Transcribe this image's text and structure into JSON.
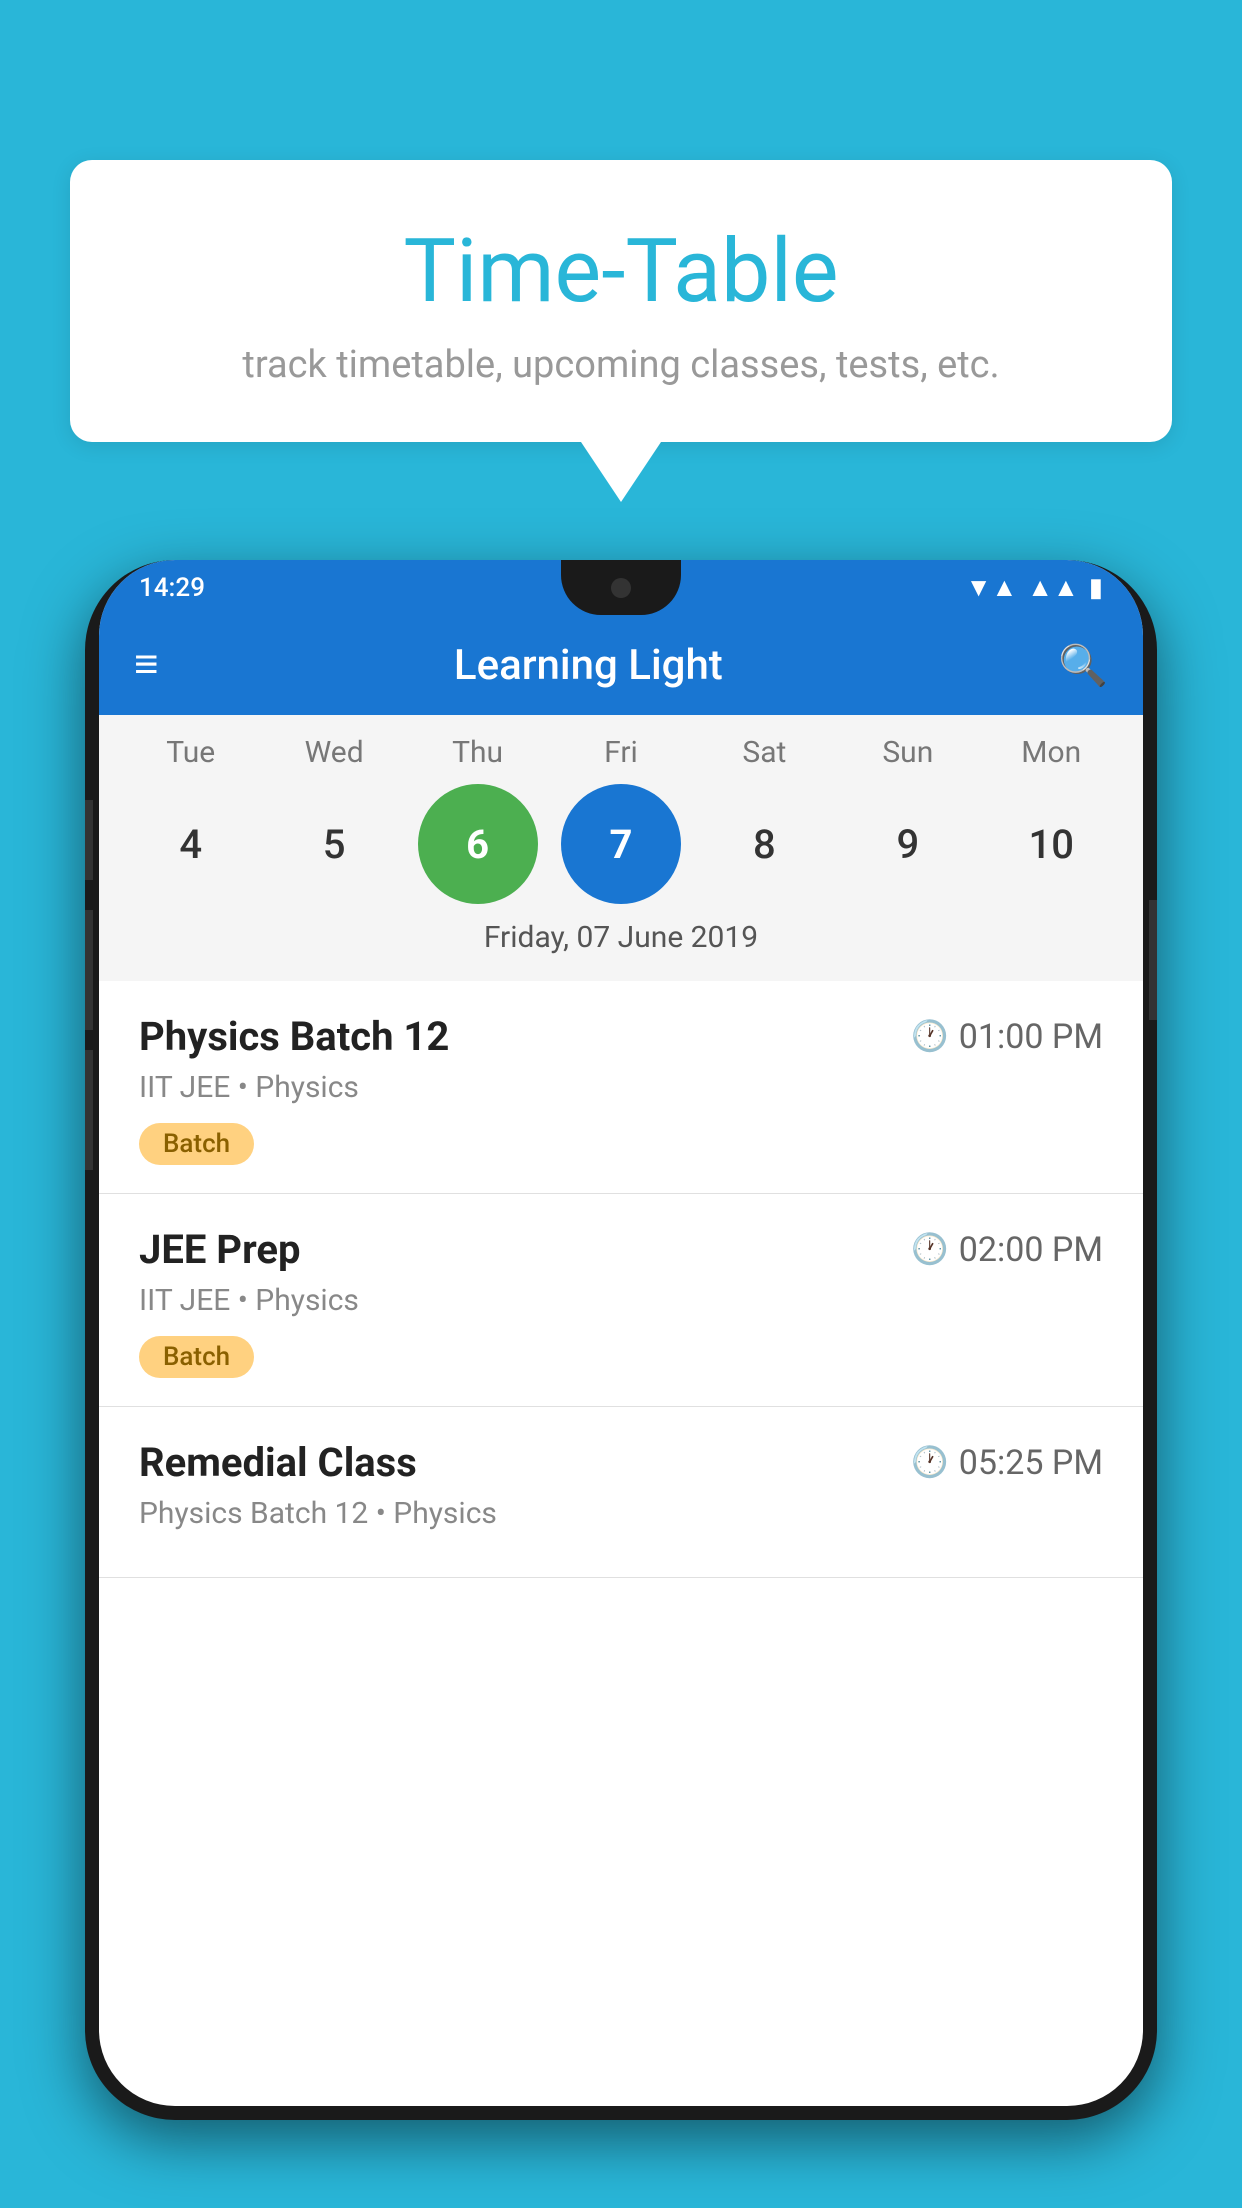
{
  "background": {
    "color": "#29b6d8"
  },
  "speech_bubble": {
    "title": "Time-Table",
    "subtitle": "track timetable, upcoming classes, tests, etc."
  },
  "phone": {
    "status_bar": {
      "time": "14:29"
    },
    "app_bar": {
      "title": "Learning Light"
    },
    "calendar": {
      "days": [
        {
          "label": "Tue",
          "number": "4",
          "state": "normal"
        },
        {
          "label": "Wed",
          "number": "5",
          "state": "normal"
        },
        {
          "label": "Thu",
          "number": "6",
          "state": "today"
        },
        {
          "label": "Fri",
          "number": "7",
          "state": "selected"
        },
        {
          "label": "Sat",
          "number": "8",
          "state": "normal"
        },
        {
          "label": "Sun",
          "number": "9",
          "state": "normal"
        },
        {
          "label": "Mon",
          "number": "10",
          "state": "normal"
        }
      ],
      "selected_date_label": "Friday, 07 June 2019"
    },
    "classes": [
      {
        "name": "Physics Batch 12",
        "time": "01:00 PM",
        "subtitle": "IIT JEE • Physics",
        "badge": "Batch"
      },
      {
        "name": "JEE Prep",
        "time": "02:00 PM",
        "subtitle": "IIT JEE • Physics",
        "badge": "Batch"
      },
      {
        "name": "Remedial Class",
        "time": "05:25 PM",
        "subtitle": "Physics Batch 12 • Physics",
        "badge": null
      }
    ]
  }
}
